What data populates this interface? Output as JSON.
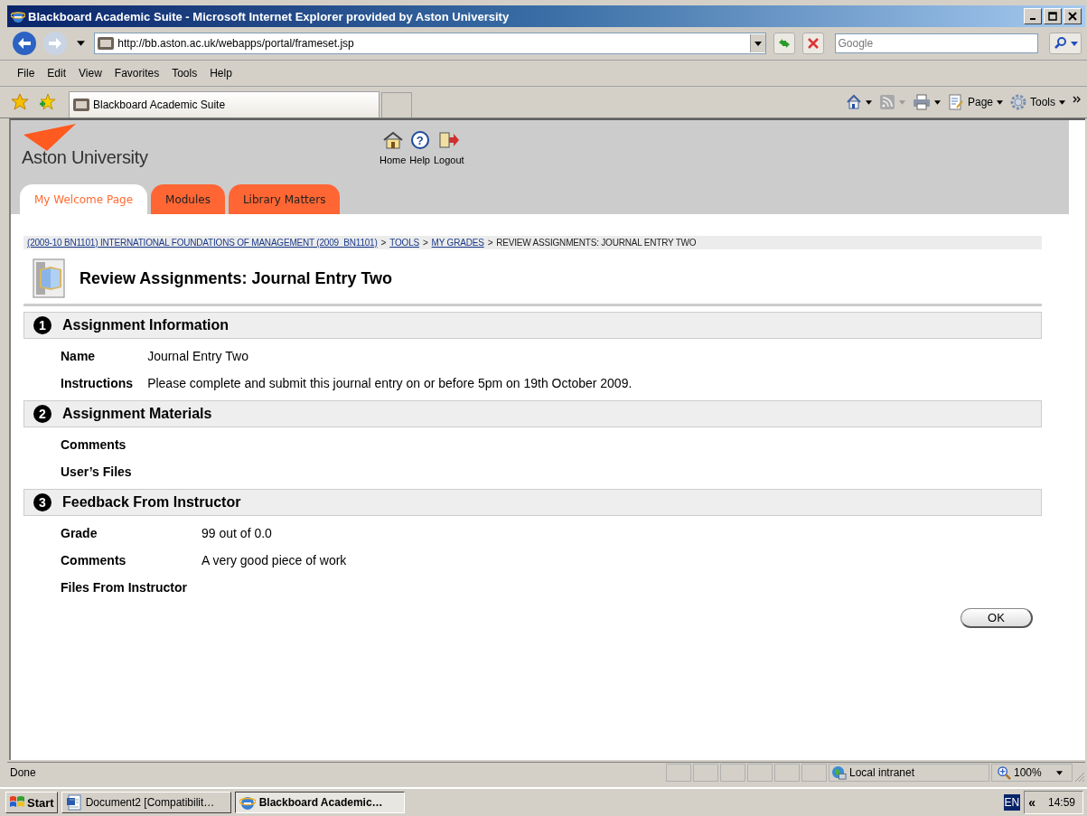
{
  "window": {
    "title": "Blackboard Academic Suite - Microsoft Internet Explorer provided by Aston University"
  },
  "address": {
    "url": "http://bb.aston.ac.uk/webapps/portal/frameset.jsp"
  },
  "search": {
    "placeholder": "Google"
  },
  "menu": [
    "File",
    "Edit",
    "View",
    "Favorites",
    "Tools",
    "Help"
  ],
  "browser_tab": {
    "label": "Blackboard Academic Suite"
  },
  "command_bar": [
    {
      "kind": "home"
    },
    {
      "kind": "feed"
    },
    {
      "kind": "print"
    },
    {
      "kind": "page",
      "label": "Page"
    },
    {
      "kind": "tools",
      "label": "Tools"
    }
  ],
  "header": {
    "logo": "Aston University",
    "nav": [
      {
        "kind": "home",
        "label": "Home"
      },
      {
        "kind": "help",
        "glyph": "?",
        "label": "Help"
      },
      {
        "kind": "logout",
        "label": "Logout"
      }
    ],
    "tabs": [
      {
        "label": "My Welcome Page",
        "selected": true
      },
      {
        "label": "Modules",
        "selected": false
      },
      {
        "label": "Library Matters",
        "selected": false
      }
    ]
  },
  "breadcrumb": [
    {
      "kind": "link",
      "text": "(2009-10 BN1101) INTERNATIONAL FOUNDATIONS OF MANAGEMENT (2009_BN1101)"
    },
    {
      "kind": "sep",
      "text": ">"
    },
    {
      "kind": "link",
      "text": "TOOLS"
    },
    {
      "kind": "sep",
      "text": ">"
    },
    {
      "kind": "link",
      "text": "MY GRADES"
    },
    {
      "kind": "sep",
      "text": ">"
    },
    {
      "kind": "current",
      "text": "REVIEW ASSIGNMENTS: JOURNAL ENTRY TWO"
    }
  ],
  "page_title": "Review Assignments: Journal Entry Two",
  "sections": [
    {
      "number": "1",
      "title": "Assignment Information",
      "fields": [
        {
          "label": "Name",
          "value": "Journal Entry Two"
        },
        {
          "label": "Instructions",
          "value": "Please complete and submit this journal entry on or before 5pm on 19th October 2009."
        }
      ]
    },
    {
      "number": "2",
      "title": "Assignment Materials",
      "fields": [
        {
          "label": "Comments"
        },
        {
          "label": "User’s Files"
        }
      ]
    },
    {
      "number": "3",
      "title": "Feedback From Instructor",
      "fields": [
        {
          "label": "Grade",
          "value": "99 out of 0.0"
        },
        {
          "label": "Comments",
          "value": "A very good piece of work"
        },
        {
          "label": "Files From Instructor"
        }
      ]
    }
  ],
  "ok_button": "OK",
  "status_bar": {
    "text": "Done",
    "zone": "Local intranet",
    "zoom": "100%"
  },
  "taskbar": {
    "start": "Start",
    "tasks": [
      {
        "kind": "word",
        "label": "Document2 [Compatibilit…",
        "selected": false
      },
      {
        "kind": "ie",
        "label": "Blackboard Academic…",
        "selected": true
      }
    ],
    "language": "EN",
    "expand": "«",
    "clock": "14:59"
  }
}
